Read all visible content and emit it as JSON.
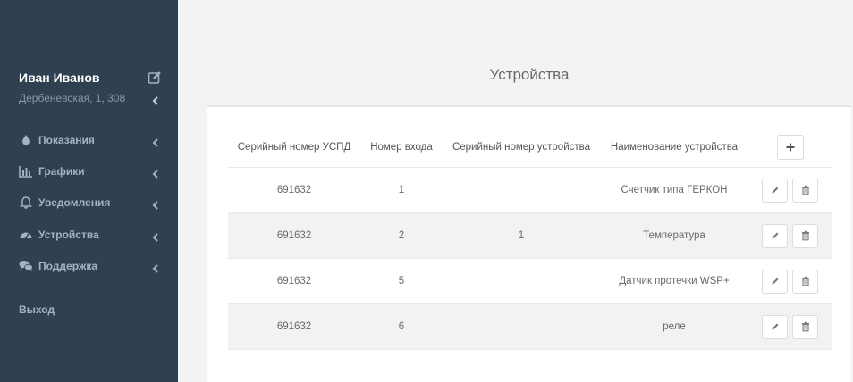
{
  "sidebar": {
    "user_name": "Иван Иванов",
    "address": "Дербеневская, 1, 308",
    "items": [
      {
        "label": "Показания",
        "icon": "drop-icon"
      },
      {
        "label": "Графики",
        "icon": "bar-chart-icon"
      },
      {
        "label": "Уведомления",
        "icon": "bell-icon"
      },
      {
        "label": "Устройства",
        "icon": "dashboard-icon"
      },
      {
        "label": "Поддержка",
        "icon": "chat-icon"
      }
    ],
    "logout_label": "Выход"
  },
  "main": {
    "title": "Устройства",
    "table": {
      "columns": [
        "Серийный номер УСПД",
        "Номер входа",
        "Серийный номер устройства",
        "Наименование устройства"
      ],
      "rows": [
        {
          "uspd": "691632",
          "input": "1",
          "serial": "",
          "name": "Счетчик типа ГЕРКОН"
        },
        {
          "uspd": "691632",
          "input": "2",
          "serial": "1",
          "name": "Температура"
        },
        {
          "uspd": "691632",
          "input": "5",
          "serial": "",
          "name": "Датчик протечки WSP+"
        },
        {
          "uspd": "691632",
          "input": "6",
          "serial": "",
          "name": "реле"
        }
      ]
    }
  },
  "colors": {
    "sidebar_bg": "#2f4050",
    "page_bg": "#f3f3f4",
    "stripe": "#f2f2f2"
  }
}
